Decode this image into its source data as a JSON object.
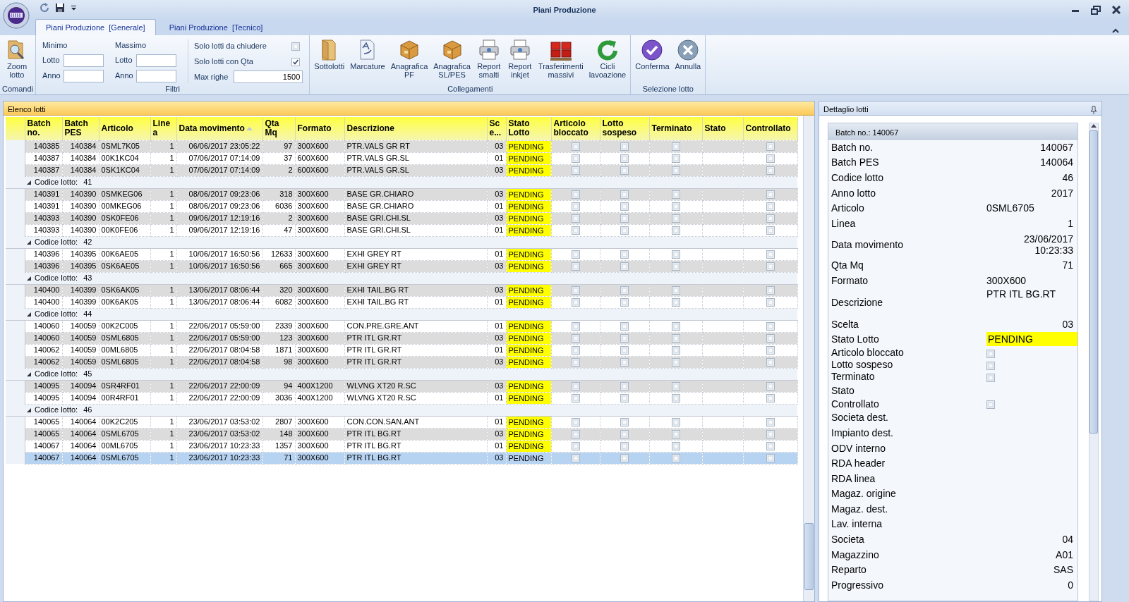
{
  "window": {
    "title": "Piani Produzione"
  },
  "tabs": [
    {
      "label": "Piani Produzione  [Generale]",
      "selected": true
    },
    {
      "label": "Piani Produzione  [Tecnico]",
      "selected": false
    }
  ],
  "ribbon": {
    "groups": [
      {
        "title": "Comandi",
        "kind": "buttons",
        "buttons": [
          {
            "label": "Zoom lotto",
            "kind": "zoom"
          }
        ]
      },
      {
        "title": "Filtri",
        "kind": "filters",
        "ranges": [
          {
            "heading": "Minimo",
            "fields": [
              {
                "label": "Lotto"
              },
              {
                "label": "Anno"
              }
            ]
          },
          {
            "heading": "Massimo",
            "fields": [
              {
                "label": "Lotto"
              },
              {
                "label": "Anno"
              }
            ]
          }
        ],
        "options": [
          {
            "label": "Solo lotti da chiudere",
            "checked": false
          },
          {
            "label": "Solo lotti con Qta",
            "checked": true
          }
        ],
        "max_rows": {
          "label": "Max righe",
          "value": "1500"
        }
      },
      {
        "title": "Collegamenti",
        "kind": "buttons",
        "buttons": [
          {
            "label": "Sottolotti",
            "kind": "folder"
          },
          {
            "label": "Marcature",
            "kind": "document"
          },
          {
            "label": "Anagrafica PF",
            "kind": "box"
          },
          {
            "label": "Anagrafica SL/PES",
            "kind": "box"
          },
          {
            "label": "Report smalti",
            "kind": "printer"
          },
          {
            "label": "Report inkjet",
            "kind": "printer"
          },
          {
            "label": "Trasferimenti massivi",
            "kind": "crates"
          },
          {
            "label": "Cicli lavoazione",
            "kind": "refresh"
          }
        ]
      },
      {
        "title": "Selezione lotto",
        "kind": "buttons",
        "buttons": [
          {
            "label": "Conferma",
            "kind": "confirm"
          },
          {
            "label": "Annulla",
            "kind": "cancel"
          }
        ]
      }
    ]
  },
  "list_panel": {
    "title": "Elenco lotti",
    "columns": [
      {
        "label": "Batch no.",
        "kind": "number"
      },
      {
        "label": "Batch PES",
        "kind": "number"
      },
      {
        "label": "Articolo",
        "kind": "text"
      },
      {
        "label": "Line a",
        "kind": "number"
      },
      {
        "label": "Data movimento",
        "kind": "number",
        "sorted": true
      },
      {
        "label": "Qta Mq",
        "kind": "number"
      },
      {
        "label": "Formato",
        "kind": "text"
      },
      {
        "label": "Descrizione",
        "kind": "text"
      },
      {
        "label": "Sc e...",
        "kind": "number"
      },
      {
        "label": "Stato Lotto",
        "kind": "status"
      },
      {
        "label": "Articolo bloccato",
        "kind": "check"
      },
      {
        "label": "Lotto sospeso",
        "kind": "check"
      },
      {
        "label": "Terminato",
        "kind": "check"
      },
      {
        "label": "Stato",
        "kind": "text"
      },
      {
        "label": "Controllato",
        "kind": "check"
      }
    ],
    "groups": [
      {
        "rows": [
          {
            "batch_no": "140385",
            "batch_pes": "140384",
            "articolo": "0SML7K05",
            "linea": "1",
            "data_movimento": "06/06/2017 23:05:22",
            "qta_mq": "97",
            "formato": "300X600",
            "descrizione": "PTR.VALS GR RT",
            "scelta": "03",
            "stato_lotto": "PENDING",
            "articolo_bloccato": false,
            "lotto_sospeso": false,
            "terminato": false,
            "controllato": false,
            "shaded": true,
            "selected": false
          },
          {
            "batch_no": "140387",
            "batch_pes": "140384",
            "articolo": "00K1KC04",
            "linea": "1",
            "data_movimento": "07/06/2017 07:14:09",
            "qta_mq": "37",
            "formato": "600X600",
            "descrizione": "PTR.VALS GR.SL",
            "scelta": "01",
            "stato_lotto": "PENDING",
            "articolo_bloccato": false,
            "lotto_sospeso": false,
            "terminato": false,
            "controllato": false,
            "shaded": false,
            "selected": false
          },
          {
            "batch_no": "140387",
            "batch_pes": "140384",
            "articolo": "0SK1KC04",
            "linea": "1",
            "data_movimento": "07/06/2017 07:14:09",
            "qta_mq": "2",
            "formato": "600X600",
            "descrizione": "PTR.VALS GR.SL",
            "scelta": "03",
            "stato_lotto": "PENDING",
            "articolo_bloccato": false,
            "lotto_sospeso": false,
            "terminato": false,
            "controllato": false,
            "shaded": true,
            "selected": false
          }
        ]
      },
      {
        "label": "Codice lotto:",
        "value": "41",
        "expanded": true,
        "rows": [
          {
            "batch_no": "140391",
            "batch_pes": "140390",
            "articolo": "0SMKEG06",
            "linea": "1",
            "data_movimento": "08/06/2017 09:23:06",
            "qta_mq": "318",
            "formato": "300X600",
            "descrizione": "BASE GR.CHIARO",
            "scelta": "03",
            "stato_lotto": "PENDING",
            "articolo_bloccato": false,
            "lotto_sospeso": false,
            "terminato": false,
            "controllato": false,
            "shaded": true,
            "selected": false
          },
          {
            "batch_no": "140391",
            "batch_pes": "140390",
            "articolo": "00MKEG06",
            "linea": "1",
            "data_movimento": "08/06/2017 09:23:06",
            "qta_mq": "6036",
            "formato": "300X600",
            "descrizione": "BASE GR.CHIARO",
            "scelta": "01",
            "stato_lotto": "PENDING",
            "articolo_bloccato": false,
            "lotto_sospeso": false,
            "terminato": false,
            "controllato": false,
            "shaded": false,
            "selected": false
          },
          {
            "batch_no": "140393",
            "batch_pes": "140390",
            "articolo": "0SK0FE06",
            "linea": "1",
            "data_movimento": "09/06/2017 12:19:16",
            "qta_mq": "2",
            "formato": "300X600",
            "descrizione": "BASE GRI.CHI.SL",
            "scelta": "03",
            "stato_lotto": "PENDING",
            "articolo_bloccato": false,
            "lotto_sospeso": false,
            "terminato": false,
            "controllato": false,
            "shaded": true,
            "selected": false
          },
          {
            "batch_no": "140393",
            "batch_pes": "140390",
            "articolo": "00K0FE06",
            "linea": "1",
            "data_movimento": "09/06/2017 12:19:16",
            "qta_mq": "47",
            "formato": "300X600",
            "descrizione": "BASE GRI.CHI.SL",
            "scelta": "01",
            "stato_lotto": "PENDING",
            "articolo_bloccato": false,
            "lotto_sospeso": false,
            "terminato": false,
            "controllato": false,
            "shaded": false,
            "selected": false
          }
        ]
      },
      {
        "label": "Codice lotto:",
        "value": "42",
        "expanded": true,
        "rows": [
          {
            "batch_no": "140396",
            "batch_pes": "140395",
            "articolo": "00K6AE05",
            "linea": "1",
            "data_movimento": "10/06/2017 16:50:56",
            "qta_mq": "12633",
            "formato": "300X600",
            "descrizione": "EXHI GREY RT",
            "scelta": "01",
            "stato_lotto": "PENDING",
            "articolo_bloccato": false,
            "lotto_sospeso": false,
            "terminato": false,
            "controllato": false,
            "shaded": false,
            "selected": false
          },
          {
            "batch_no": "140396",
            "batch_pes": "140395",
            "articolo": "0SK6AE05",
            "linea": "1",
            "data_movimento": "10/06/2017 16:50:56",
            "qta_mq": "665",
            "formato": "300X600",
            "descrizione": "EXHI GREY RT",
            "scelta": "03",
            "stato_lotto": "PENDING",
            "articolo_bloccato": false,
            "lotto_sospeso": false,
            "terminato": false,
            "controllato": false,
            "shaded": true,
            "selected": false
          }
        ]
      },
      {
        "label": "Codice lotto:",
        "value": "43",
        "expanded": true,
        "rows": [
          {
            "batch_no": "140400",
            "batch_pes": "140399",
            "articolo": "0SK6AK05",
            "linea": "1",
            "data_movimento": "13/06/2017 08:06:44",
            "qta_mq": "320",
            "formato": "300X600",
            "descrizione": "EXHI TAIL.BG RT",
            "scelta": "03",
            "stato_lotto": "PENDING",
            "articolo_bloccato": false,
            "lotto_sospeso": false,
            "terminato": false,
            "controllato": false,
            "shaded": true,
            "selected": false
          },
          {
            "batch_no": "140400",
            "batch_pes": "140399",
            "articolo": "00K6AK05",
            "linea": "1",
            "data_movimento": "13/06/2017 08:06:44",
            "qta_mq": "6082",
            "formato": "300X600",
            "descrizione": "EXHI TAIL.BG RT",
            "scelta": "01",
            "stato_lotto": "PENDING",
            "articolo_bloccato": false,
            "lotto_sospeso": false,
            "terminato": false,
            "controllato": false,
            "shaded": false,
            "selected": false
          }
        ]
      },
      {
        "label": "Codice lotto:",
        "value": "44",
        "expanded": true,
        "rows": [
          {
            "batch_no": "140060",
            "batch_pes": "140059",
            "articolo": "00K2C005",
            "linea": "1",
            "data_movimento": "22/06/2017 05:59:00",
            "qta_mq": "2339",
            "formato": "300X600",
            "descrizione": "CON.PRE.GRE.ANT",
            "scelta": "01",
            "stato_lotto": "PENDING",
            "articolo_bloccato": false,
            "lotto_sospeso": false,
            "terminato": false,
            "controllato": false,
            "shaded": false,
            "selected": false
          },
          {
            "batch_no": "140060",
            "batch_pes": "140059",
            "articolo": "0SML6805",
            "linea": "1",
            "data_movimento": "22/06/2017 05:59:00",
            "qta_mq": "123",
            "formato": "300X600",
            "descrizione": "PTR ITL GR.RT",
            "scelta": "03",
            "stato_lotto": "PENDING",
            "articolo_bloccato": false,
            "lotto_sospeso": false,
            "terminato": false,
            "controllato": false,
            "shaded": true,
            "selected": false
          },
          {
            "batch_no": "140062",
            "batch_pes": "140059",
            "articolo": "00ML6805",
            "linea": "1",
            "data_movimento": "22/06/2017 08:04:58",
            "qta_mq": "1871",
            "formato": "300X600",
            "descrizione": "PTR ITL GR.RT",
            "scelta": "01",
            "stato_lotto": "PENDING",
            "articolo_bloccato": false,
            "lotto_sospeso": false,
            "terminato": false,
            "controllato": false,
            "shaded": false,
            "selected": false
          },
          {
            "batch_no": "140062",
            "batch_pes": "140059",
            "articolo": "0SML6805",
            "linea": "1",
            "data_movimento": "22/06/2017 08:04:58",
            "qta_mq": "98",
            "formato": "300X600",
            "descrizione": "PTR ITL GR.RT",
            "scelta": "03",
            "stato_lotto": "PENDING",
            "articolo_bloccato": false,
            "lotto_sospeso": false,
            "terminato": false,
            "controllato": false,
            "shaded": true,
            "selected": false
          }
        ]
      },
      {
        "label": "Codice lotto:",
        "value": "45",
        "expanded": true,
        "rows": [
          {
            "batch_no": "140095",
            "batch_pes": "140094",
            "articolo": "0SR4RF01",
            "linea": "1",
            "data_movimento": "22/06/2017 22:00:09",
            "qta_mq": "94",
            "formato": "400X1200",
            "descrizione": "WLVNG XT20 R.SC",
            "scelta": "03",
            "stato_lotto": "PENDING",
            "articolo_bloccato": false,
            "lotto_sospeso": false,
            "terminato": false,
            "controllato": false,
            "shaded": true,
            "selected": false
          },
          {
            "batch_no": "140095",
            "batch_pes": "140094",
            "articolo": "00R4RF01",
            "linea": "1",
            "data_movimento": "22/06/2017 22:00:09",
            "qta_mq": "3036",
            "formato": "400X1200",
            "descrizione": "WLVNG XT20 R.SC",
            "scelta": "01",
            "stato_lotto": "PENDING",
            "articolo_bloccato": false,
            "lotto_sospeso": false,
            "terminato": false,
            "controllato": false,
            "shaded": false,
            "selected": false
          }
        ]
      },
      {
        "label": "Codice lotto:",
        "value": "46",
        "expanded": true,
        "rows": [
          {
            "batch_no": "140065",
            "batch_pes": "140064",
            "articolo": "00K2C205",
            "linea": "1",
            "data_movimento": "23/06/2017 03:53:02",
            "qta_mq": "2807",
            "formato": "300X600",
            "descrizione": "CON.CON.SAN.ANT",
            "scelta": "01",
            "stato_lotto": "PENDING",
            "articolo_bloccato": false,
            "lotto_sospeso": false,
            "terminato": false,
            "controllato": false,
            "shaded": false,
            "selected": false
          },
          {
            "batch_no": "140065",
            "batch_pes": "140064",
            "articolo": "0SML6705",
            "linea": "1",
            "data_movimento": "23/06/2017 03:53:02",
            "qta_mq": "148",
            "formato": "300X600",
            "descrizione": "PTR ITL BG.RT",
            "scelta": "03",
            "stato_lotto": "PENDING",
            "articolo_bloccato": false,
            "lotto_sospeso": false,
            "terminato": false,
            "controllato": false,
            "shaded": true,
            "selected": false
          },
          {
            "batch_no": "140067",
            "batch_pes": "140064",
            "articolo": "00ML6705",
            "linea": "1",
            "data_movimento": "23/06/2017 10:23:33",
            "qta_mq": "1357",
            "formato": "300X600",
            "descrizione": "PTR ITL BG.RT",
            "scelta": "01",
            "stato_lotto": "PENDING",
            "articolo_bloccato": false,
            "lotto_sospeso": false,
            "terminato": false,
            "controllato": false,
            "shaded": false,
            "selected": false
          },
          {
            "batch_no": "140067",
            "batch_pes": "140064",
            "articolo": "0SML6705",
            "linea": "1",
            "data_movimento": "23/06/2017 10:23:33",
            "qta_mq": "71",
            "formato": "300X600",
            "descrizione": "PTR ITL BG.RT",
            "scelta": "03",
            "stato_lotto": "PENDING",
            "articolo_bloccato": false,
            "lotto_sospeso": false,
            "terminato": false,
            "controllato": false,
            "shaded": true,
            "selected": true
          }
        ]
      }
    ]
  },
  "detail_panel": {
    "title": "Dettaglio lotti",
    "card_title": "Batch no.: 140067",
    "fields": [
      {
        "label": "Batch no.",
        "kind": "number",
        "value": "140067"
      },
      {
        "label": "Batch PES",
        "kind": "number",
        "value": "140064"
      },
      {
        "label": "Codice lotto",
        "kind": "number",
        "value": "46"
      },
      {
        "label": "Anno lotto",
        "kind": "number",
        "value": "2017"
      },
      {
        "label": "Articolo",
        "kind": "text",
        "value": "0SML6705"
      },
      {
        "label": "Linea",
        "kind": "number",
        "value": "1"
      },
      {
        "label": "Data movimento",
        "kind": "lines",
        "lines": [
          "23/06/2017",
          "10:23:33"
        ]
      },
      {
        "label": "Qta Mq",
        "kind": "number",
        "value": "71"
      },
      {
        "label": "Formato",
        "kind": "text",
        "value": "300X600"
      },
      {
        "label": "Descrizione",
        "kind": "memo",
        "value": "PTR ITL BG.RT"
      },
      {
        "label": "Scelta",
        "kind": "number",
        "value": "03"
      },
      {
        "label": "Stato Lotto",
        "kind": "status",
        "value": "PENDING"
      },
      {
        "label": "Articolo bloccato",
        "kind": "check",
        "checked": false
      },
      {
        "label": "Lotto sospeso",
        "kind": "check",
        "checked": false
      },
      {
        "label": "Terminato",
        "kind": "check",
        "checked": false
      },
      {
        "label": "Stato",
        "kind": "empty"
      },
      {
        "label": "Controllato",
        "kind": "check",
        "checked": false
      },
      {
        "label": "Societa dest.",
        "kind": "empty"
      },
      {
        "label": "Impianto dest.",
        "kind": "empty"
      },
      {
        "label": "ODV interno",
        "kind": "empty"
      },
      {
        "label": "RDA header",
        "kind": "empty"
      },
      {
        "label": "RDA linea",
        "kind": "empty"
      },
      {
        "label": "Magaz. origine",
        "kind": "empty"
      },
      {
        "label": "Magaz. dest.",
        "kind": "empty"
      },
      {
        "label": "Lav. interna",
        "kind": "empty"
      },
      {
        "label": "Societa",
        "kind": "number",
        "value": "04"
      },
      {
        "label": "Magazzino",
        "kind": "number",
        "value": "A01"
      },
      {
        "label": "Reparto",
        "kind": "number",
        "value": "SAS"
      },
      {
        "label": "Progressivo",
        "kind": "number",
        "value": "0"
      }
    ]
  }
}
